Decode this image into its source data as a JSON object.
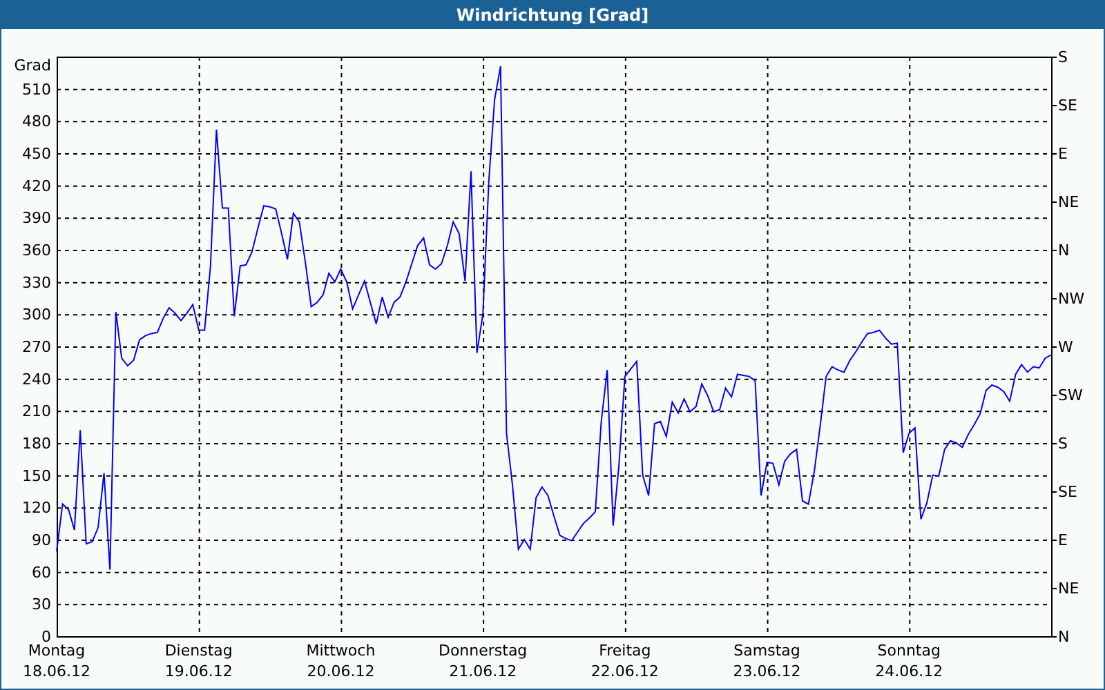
{
  "window": {
    "title": "Windrichtung [Grad]"
  },
  "chart": {
    "chart_data": {
      "type": "line",
      "ylabel": "Grad",
      "categories": [
        "Montag\n18.06.12",
        null,
        null,
        null,
        null,
        null,
        null,
        null,
        null,
        null,
        null,
        null,
        null,
        null,
        null,
        null,
        null,
        null,
        null,
        null,
        null,
        null,
        null,
        null,
        "Dienstag\n19.06.12",
        null,
        null,
        null,
        null,
        null,
        null,
        null,
        null,
        null,
        null,
        null,
        null,
        null,
        null,
        null,
        null,
        null,
        null,
        null,
        null,
        null,
        null,
        null,
        "Mittwoch\n20.06.12",
        null,
        null,
        null,
        null,
        null,
        null,
        null,
        null,
        null,
        null,
        null,
        null,
        null,
        null,
        null,
        null,
        null,
        null,
        null,
        null,
        null,
        null,
        null,
        "Donnerstag\n21.06.12",
        null,
        null,
        null,
        null,
        null,
        null,
        null,
        null,
        null,
        null,
        null,
        null,
        null,
        null,
        null,
        null,
        null,
        null,
        null,
        null,
        null,
        null,
        null,
        "Freitag\n22.06.12",
        null,
        null,
        null,
        null,
        null,
        null,
        null,
        null,
        null,
        null,
        null,
        null,
        null,
        null,
        null,
        null,
        null,
        null,
        null,
        null,
        null,
        null,
        null,
        "Samstag\n23.06.12",
        null,
        null,
        null,
        null,
        null,
        null,
        null,
        null,
        null,
        null,
        null,
        null,
        null,
        null,
        null,
        null,
        null,
        null,
        null,
        null,
        null,
        null,
        null,
        "Sonntag\n24.06.12",
        null,
        null,
        null,
        null,
        null,
        null,
        null,
        null,
        null,
        null,
        null,
        null,
        null,
        null,
        null,
        null,
        null,
        null,
        null,
        null,
        null,
        null,
        null,
        null
      ],
      "series": [
        {
          "color": "#0000ff",
          "values": [
            79,
            123,
            118,
            99,
            192,
            86,
            88,
            101,
            152,
            62,
            302,
            259,
            252,
            257,
            276,
            280,
            282,
            283,
            296,
            306,
            301,
            294,
            301,
            309,
            285,
            285,
            345,
            472,
            399,
            399,
            298,
            345,
            346,
            358,
            380,
            401,
            400,
            398,
            375,
            351,
            394,
            386,
            349,
            307,
            311,
            318,
            338,
            330,
            342,
            330,
            305,
            318,
            331,
            311,
            291,
            316,
            297,
            311,
            316,
            330,
            347,
            364,
            371,
            346,
            342,
            347,
            364,
            386,
            375,
            331,
            433,
            264,
            300,
            424,
            500,
            531,
            189,
            141,
            81,
            90,
            81,
            129,
            139,
            131,
            112,
            94,
            91,
            89,
            97,
            105,
            110,
            116,
            200,
            248,
            103,
            159,
            242,
            249,
            256,
            150,
            131,
            198,
            200,
            186,
            218,
            208,
            221,
            209,
            214,
            235,
            224,
            209,
            211,
            231,
            223,
            244,
            243,
            242,
            238,
            131,
            162,
            161,
            141,
            163,
            170,
            174,
            126,
            123,
            154,
            197,
            242,
            251,
            248,
            246,
            257,
            265,
            274,
            282,
            283,
            285,
            278,
            272,
            273,
            171,
            189,
            194,
            109,
            124,
            150,
            149,
            174,
            182,
            180,
            176,
            188,
            197,
            207,
            229,
            234,
            232,
            228,
            219,
            244,
            253,
            246,
            251,
            250,
            259,
            262
          ]
        }
      ],
      "ylim": [
        0,
        540
      ],
      "grid": true,
      "yticks": [
        0,
        30,
        60,
        90,
        120,
        150,
        180,
        210,
        240,
        270,
        300,
        330,
        360,
        390,
        420,
        450,
        480,
        510
      ]
    },
    "compass_labels": [
      "S",
      "SE",
      "E",
      "NE",
      "N",
      "NW",
      "W",
      "SW",
      "S",
      "SE",
      "E",
      "NE",
      "N"
    ]
  }
}
